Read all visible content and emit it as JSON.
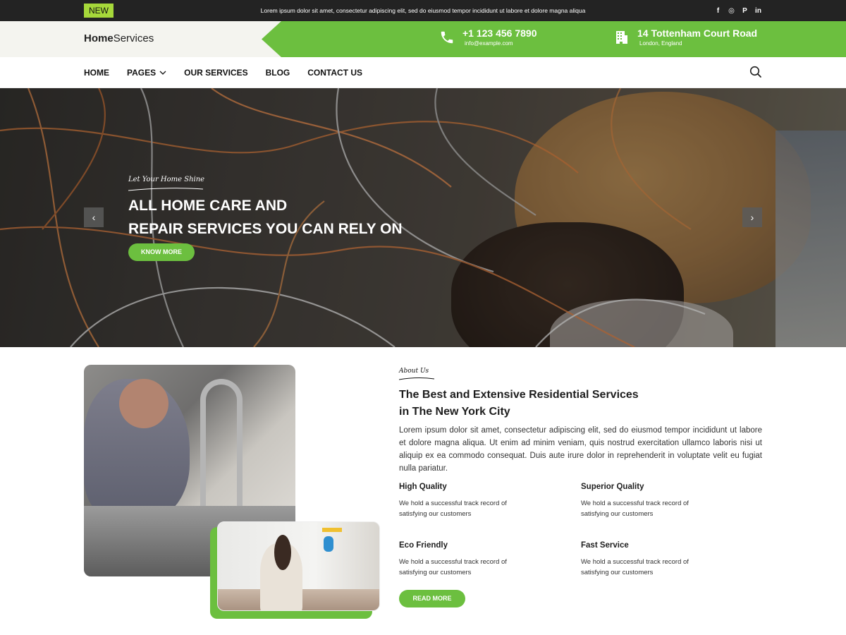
{
  "topbar": {
    "badge": "NEW",
    "message": "Lorem ipsum dolor sit amet, consectetur adipiscing elit, sed do eiusmod tempor incididunt ut labore et dolore magna aliqua",
    "socials": [
      {
        "icon": "facebook-icon",
        "glyph": "f"
      },
      {
        "icon": "instagram-icon",
        "glyph": "◎"
      },
      {
        "icon": "pinterest-icon",
        "glyph": "P"
      },
      {
        "icon": "linkedin-icon",
        "glyph": "in"
      }
    ]
  },
  "header": {
    "logo_bold": "Home",
    "logo_rest": "Services",
    "phone": "+1 123 456 7890",
    "email": "info@example.com",
    "address": "14 Tottenham Court Road",
    "city": "London, England"
  },
  "nav": {
    "items": [
      "HOME",
      "PAGES",
      "OUR SERVICES",
      "BLOG",
      "CONTACT US"
    ]
  },
  "hero": {
    "tagline": "Let Your Home Shine",
    "title_line1": "ALL HOME CARE AND",
    "title_line2": "REPAIR SERVICES YOU CAN RELY ON",
    "button": "KNOW MORE",
    "prev": "‹",
    "next": "›"
  },
  "about": {
    "tag": "About Us",
    "title_line1": "The Best and Extensive Residential Services",
    "title_line2": "in The New York City",
    "text": "Lorem ipsum dolor sit amet, consectetur adipiscing elit, sed do eiusmod tempor incididunt ut labore et dolore magna aliqua. Ut enim ad minim veniam, quis nostrud exercitation ullamco laboris nisi ut aliquip  ex ea commodo consequat. Duis aute irure dolor in reprehenderit in voluptate velit eu fugiat nulla  pariatur.",
    "features": [
      {
        "title": "High Quality",
        "desc": "We hold a successful track record of satisfying our customers"
      },
      {
        "title": "Superior Quality",
        "desc": "We hold a successful track record of satisfying our customers"
      },
      {
        "title": "Eco Friendly",
        "desc": "We hold a successful track record of satisfying our customers"
      },
      {
        "title": "Fast Service",
        "desc": "We hold a successful track record of satisfying our customers"
      }
    ],
    "button": "READ MORE"
  },
  "colors": {
    "accent": "#6cbf3f",
    "badge": "#a6d83a",
    "topbar": "#232323"
  }
}
